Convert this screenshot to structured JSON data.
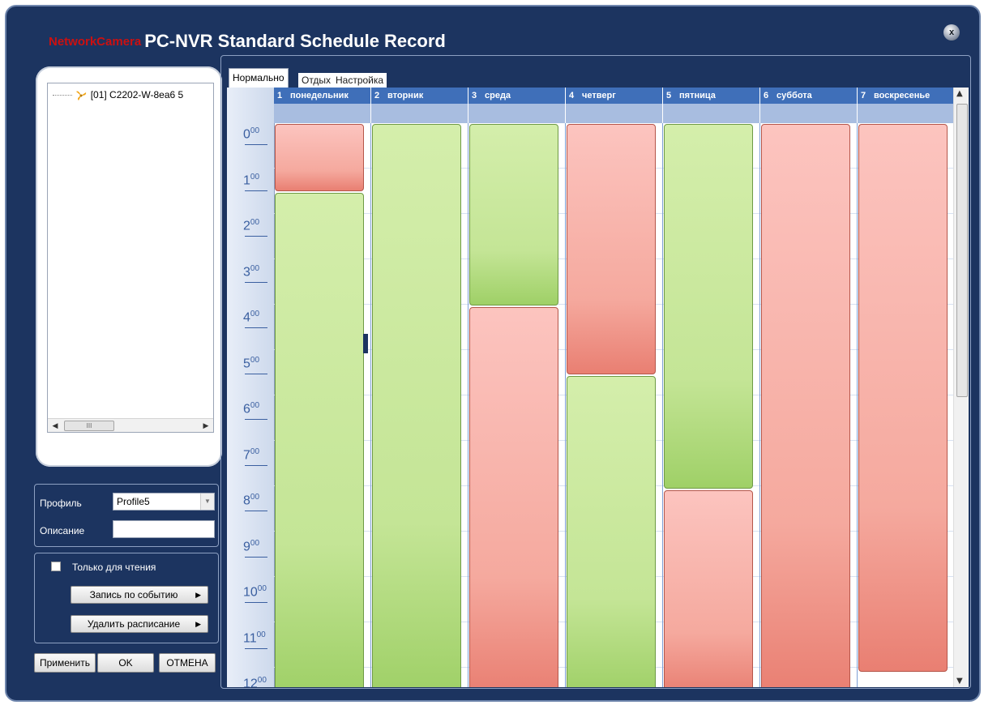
{
  "window": {
    "brand": "NetworkCamera",
    "title": "PC-NVR Standard Schedule Record",
    "close_label": "x"
  },
  "device_tree": {
    "node": "[01] C2202-W-8ea6  5",
    "scroll_thumb": "III"
  },
  "profile": {
    "profile_label": "Профиль",
    "profile_value": "Profile5",
    "description_label": "Описание",
    "description_value": ""
  },
  "options": {
    "readonly_label": "Только для чтения",
    "event_record_button": "Запись по событию",
    "delete_schedule_button": "Удалить расписание"
  },
  "footer": {
    "apply": "Применить",
    "ok": "OK",
    "cancel": "ОТМЕНА"
  },
  "tabs": {
    "normal": "Нормально",
    "rest": "Отдых",
    "settings": "Настройка"
  },
  "days": [
    {
      "num": "1",
      "name": "понедельник"
    },
    {
      "num": "2",
      "name": "вторник"
    },
    {
      "num": "3",
      "name": "среда"
    },
    {
      "num": "4",
      "name": "четверг"
    },
    {
      "num": "5",
      "name": "пятница"
    },
    {
      "num": "6",
      "name": "суббота"
    },
    {
      "num": "7",
      "name": "воскресенье"
    }
  ],
  "hours": [
    "0",
    "1",
    "2",
    "3",
    "4",
    "5",
    "6",
    "7",
    "8",
    "9",
    "10",
    "11",
    "12"
  ],
  "minutes_sup": "00",
  "schedule": [
    [
      {
        "type": "rest",
        "start": 0,
        "end": 1.5
      },
      {
        "type": "normal",
        "start": 1.5,
        "end": 12.5
      }
    ],
    [
      {
        "type": "normal",
        "start": 0,
        "end": 12.5
      }
    ],
    [
      {
        "type": "normal",
        "start": 0,
        "end": 4
      },
      {
        "type": "rest",
        "start": 4,
        "end": 12.5
      }
    ],
    [
      {
        "type": "rest",
        "start": 0,
        "end": 5.5
      },
      {
        "type": "normal",
        "start": 5.5,
        "end": 12.5
      }
    ],
    [
      {
        "type": "normal",
        "start": 0,
        "end": 8
      },
      {
        "type": "rest",
        "start": 8,
        "end": 12.5
      }
    ],
    [
      {
        "type": "rest",
        "start": 0,
        "end": 12.5
      }
    ],
    [
      {
        "type": "rest",
        "start": 0,
        "end": 12
      }
    ]
  ],
  "colors": {
    "window_bg": "#1c3460",
    "normal_block": "#c4e596",
    "rest_block": "#f5a99e",
    "day_header": "#3f6fb9"
  }
}
